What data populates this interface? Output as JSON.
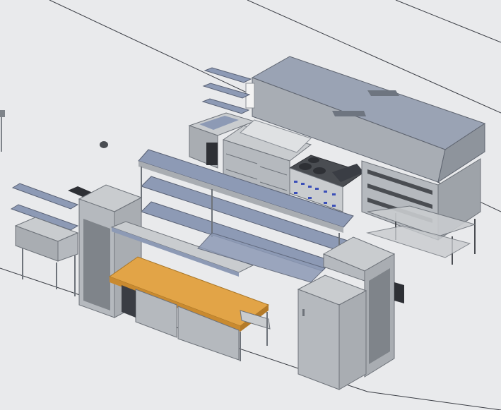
{
  "scene": {
    "subject": "commercial-kitchen-equipment-layout",
    "view": "isometric-3d-render",
    "colors": {
      "background": "#e9eaec",
      "floor_line": "#3a3d44",
      "steel_light": "#c9cccf",
      "steel_mid": "#a9adb2",
      "steel_dark": "#7f848a",
      "shelf_blue": "#8d9ab5",
      "hood_top": "#9aa3b4",
      "butcher_block": "#e2a447",
      "burner_blue": "#3b4fb8",
      "frame_dark": "#4a4d52"
    },
    "items": [
      "exhaust-hood",
      "wall-shelves",
      "hand-sink",
      "refrigerated-prep-base",
      "range-with-burners",
      "deck-pizza-oven",
      "overshelf-pass-through",
      "three-compartment-sink",
      "reach-in-cabinet-left",
      "butcher-block-worktable",
      "reach-in-cabinet-right"
    ]
  }
}
